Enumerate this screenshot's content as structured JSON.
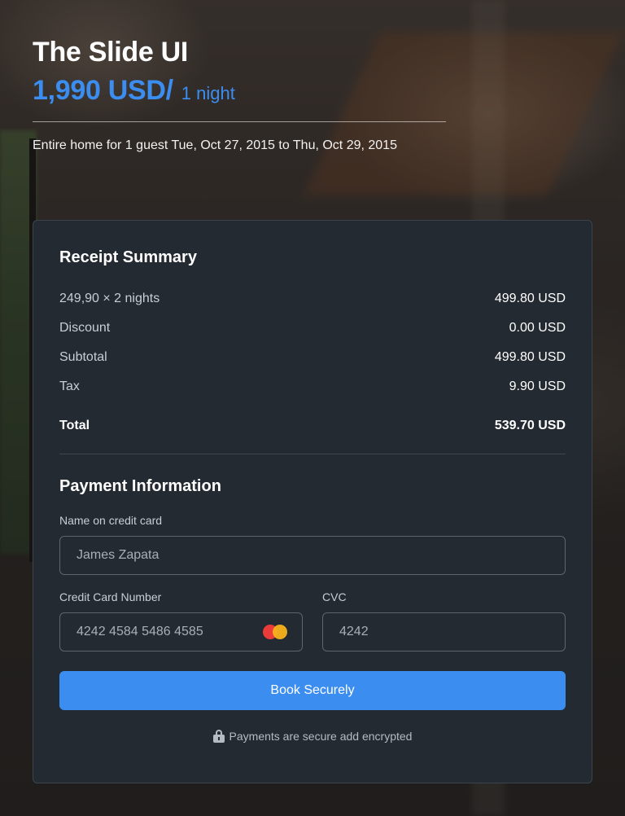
{
  "header": {
    "title": "The Slide UI",
    "price": "1,990 USD/",
    "price_unit": "1 night",
    "stay_details": "Entire home for 1 guest Tue, Oct 27, 2015 to Thu, Oct 29, 2015"
  },
  "receipt": {
    "heading": "Receipt Summary",
    "rows": [
      {
        "label": "249,90 × 2 nights",
        "value": "499.80 USD"
      },
      {
        "label": "Discount",
        "value": "0.00 USD"
      },
      {
        "label": "Subtotal",
        "value": "499.80 USD"
      },
      {
        "label": "Tax",
        "value": "9.90 USD"
      }
    ],
    "total": {
      "label": "Total",
      "value": "539.70 USD"
    }
  },
  "payment": {
    "heading": "Payment Information",
    "name_label": "Name on credit card",
    "name_value": "James Zapata",
    "card_label": "Credit Card Number",
    "card_value": "4242 4584 5486 4585",
    "card_icon": "mastercard-icon",
    "cvc_label": "CVC",
    "cvc_value": "4242",
    "book_label": "Book Securely",
    "secure_note": "Payments are secure add encrypted",
    "secure_icon": "lock-icon"
  },
  "colors": {
    "accent": "#3b8ef0",
    "card_bg": "#232a31"
  }
}
